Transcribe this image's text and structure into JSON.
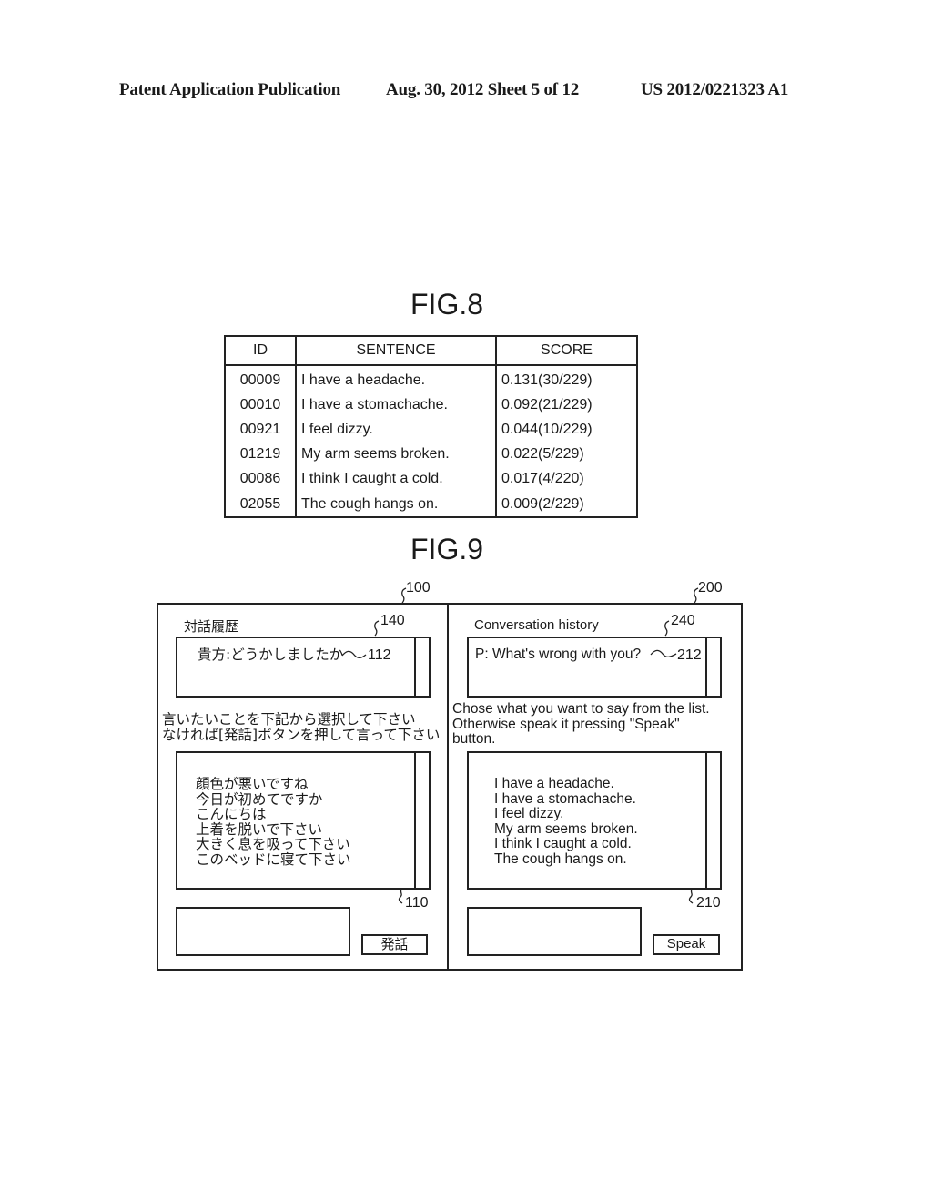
{
  "header": {
    "publication": "Patent Application Publication",
    "date_sheet": "Aug. 30, 2012  Sheet 5 of 12",
    "number": "US 2012/0221323 A1"
  },
  "fig8": {
    "title": "FIG.8",
    "columns": [
      "ID",
      "SENTENCE",
      "SCORE"
    ],
    "rows": [
      {
        "id": "00009",
        "sentence": "I have a headache.",
        "score": "0.131(30/229)"
      },
      {
        "id": "00010",
        "sentence": "I have a stomachache.",
        "score": "0.092(21/229)"
      },
      {
        "id": "00921",
        "sentence": "I feel dizzy.",
        "score": "0.044(10/229)"
      },
      {
        "id": "01219",
        "sentence": "My arm seems broken.",
        "score": "0.022(5/229)"
      },
      {
        "id": "00086",
        "sentence": "I think I caught a cold.",
        "score": "0.017(4/220)"
      },
      {
        "id": "02055",
        "sentence": "The cough hangs on.",
        "score": "0.009(2/229)"
      }
    ]
  },
  "fig9": {
    "title": "FIG.9",
    "left": {
      "ref": "100",
      "history_label": "対話履歴",
      "history_ref": "140",
      "history_message": "貴方:どうかしましたか",
      "message_ref": "112",
      "instruction_lines": [
        "言いたいことを下記から選択して下さい",
        "なければ[発話]ボタンを押して言って下さい"
      ],
      "list_items": [
        "顔色が悪いですね",
        "今日が初めてですか",
        "こんにちは",
        "上着を脱いで下さい",
        "大きく息を吸って下さい",
        "このベッドに寝て下さい"
      ],
      "list_ref": "110",
      "input_value": "",
      "speak_button": "発話"
    },
    "right": {
      "ref": "200",
      "history_label": "Conversation history",
      "history_ref": "240",
      "history_message": "P: What's wrong with you?",
      "message_ref": "212",
      "instruction_lines": [
        "Chose what you want to say from the list.",
        "Otherwise speak it pressing \"Speak\"",
        "button."
      ],
      "list_items": [
        "I have a headache.",
        "I have a stomachache.",
        "I feel dizzy.",
        "My arm seems broken.",
        "I think I caught a cold.",
        "The cough hangs on."
      ],
      "list_ref": "210",
      "input_value": "",
      "speak_button": "Speak"
    }
  }
}
